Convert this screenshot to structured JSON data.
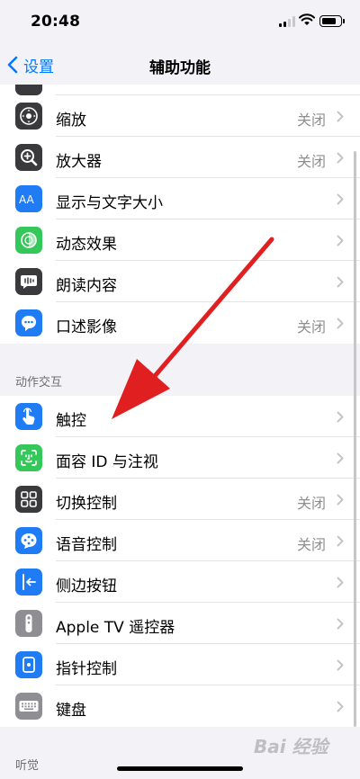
{
  "status_bar": {
    "time": "20:48"
  },
  "nav": {
    "back_label": "设置",
    "title": "辅助功能"
  },
  "vision_items": [
    {
      "label": "缩放",
      "value": "关闭",
      "icon": "zoom-icon",
      "color": "#3a3a3c"
    },
    {
      "label": "放大器",
      "value": "关闭",
      "icon": "magnifier-icon",
      "color": "#3a3a3c"
    },
    {
      "label": "显示与文字大小",
      "value": "",
      "icon": "text-size-icon",
      "color": "#1f7cf5"
    },
    {
      "label": "动态效果",
      "value": "",
      "icon": "motion-icon",
      "color": "#34c759"
    },
    {
      "label": "朗读内容",
      "value": "",
      "icon": "spoken-content-icon",
      "color": "#3a3a3c"
    },
    {
      "label": "口述影像",
      "value": "关闭",
      "icon": "audio-description-icon",
      "color": "#1f7cf5"
    }
  ],
  "section_motor": "动作交互",
  "motor_items": [
    {
      "label": "触控",
      "value": "",
      "icon": "touch-icon",
      "color": "#1f7cf5"
    },
    {
      "label": "面容 ID 与注视",
      "value": "",
      "icon": "face-id-icon",
      "color": "#34c759"
    },
    {
      "label": "切换控制",
      "value": "关闭",
      "icon": "switch-control-icon",
      "color": "#3a3a3c"
    },
    {
      "label": "语音控制",
      "value": "关闭",
      "icon": "voice-control-icon",
      "color": "#1f7cf5"
    },
    {
      "label": "侧边按钮",
      "value": "",
      "icon": "side-button-icon",
      "color": "#1f7cf5"
    },
    {
      "label": "Apple TV 遥控器",
      "value": "",
      "icon": "tv-remote-icon",
      "color": "#8e8e93"
    },
    {
      "label": "指针控制",
      "value": "",
      "icon": "pointer-control-icon",
      "color": "#1f7cf5"
    },
    {
      "label": "键盘",
      "value": "",
      "icon": "keyboard-icon",
      "color": "#8e8e93"
    }
  ],
  "section_hearing": "听觉",
  "watermark": "Bai 经验"
}
